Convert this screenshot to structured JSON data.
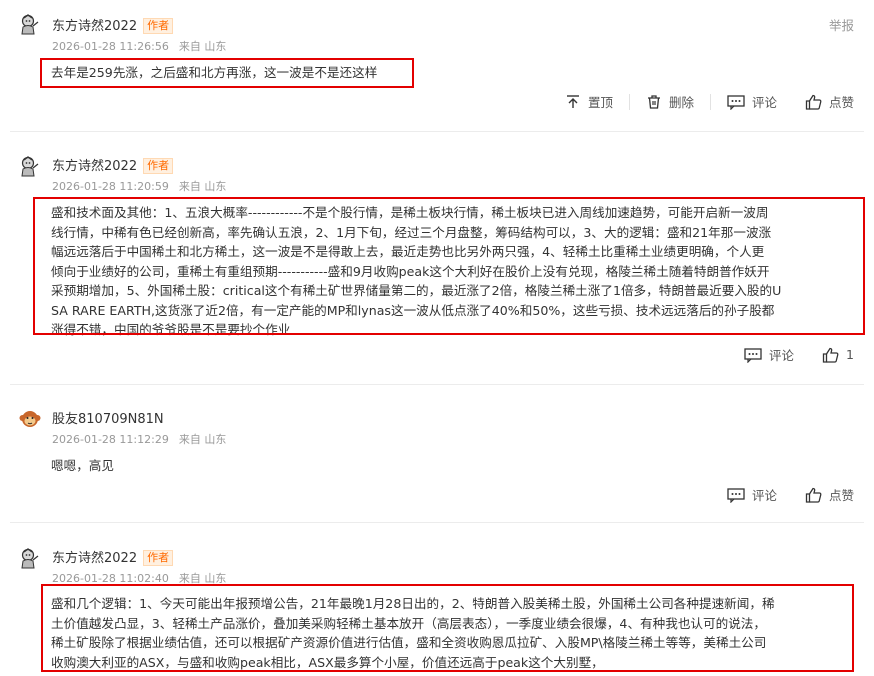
{
  "author_tag": "作者",
  "actions": {
    "pin": "置顶",
    "delete": "删除",
    "comment": "评论",
    "like": "点赞",
    "report": "举报"
  },
  "comments": [
    {
      "username": "东方诗然2022",
      "time": "2026-01-28 11:26:56",
      "location": "来自 山东",
      "text": "去年是259先涨，之后盛和北方再涨，这一波是不是还这样"
    },
    {
      "username": "东方诗然2022",
      "time": "2026-01-28 11:20:59",
      "location": "来自 山东",
      "lines": [
        "盛和技术面及其他：1、五浪大概率------------不是个股行情，是稀土板块行情，稀土板块已进入周线加速趋势，可能开启新一波周",
        "线行情，中稀有色已经创新高，率先确认五浪，2、1月下旬，经过三个月盘整，筹码结构可以，3、大的逻辑：盛和21年那一波涨",
        "幅远远落后于中国稀土和北方稀土，这一波是不是得敢上去，最近走势也比另外两只强，4、轻稀土比重稀土业绩更明确，个人更",
        "倾向于业绩好的公司，重稀土有重组预期-----------盛和9月收购peak这个大利好在股价上没有兑现，格陵兰稀土随着特朗普作妖开",
        "采预期增加，5、外国稀土股：critical这个有稀土矿世界储量第二的，最近涨了2倍，格陵兰稀土涨了1倍多，特朗普最近要入股的U",
        "SA RARE EARTH,这货涨了近2倍，有一定产能的MP和lynas这一波从低点涨了40%和50%，这些亏损、技术远远落后的孙子股都",
        "涨得不错，中国的爷爷股是不是要抄个作业"
      ],
      "like_count": "1"
    },
    {
      "username": "股友810709N81N",
      "time": "2026-01-28 11:12:29",
      "location": "来自 山东",
      "text": "嗯嗯，高见"
    },
    {
      "username": "东方诗然2022",
      "time": "2026-01-28 11:02:40",
      "location": "来自 山东",
      "lines": [
        "盛和几个逻辑：1、今天可能出年报预增公告，21年最晚1月28日出的，2、特朗普入股美稀土股，外国稀土公司各种提速新闻，稀",
        "土价值越发凸显，3、轻稀土产品涨价，叠加美采购轻稀土基本放开（高层表态），一季度业绩会很爆，4、有种我也认可的说法，",
        "稀土矿股除了根据业绩估值，还可以根据矿产资源价值进行估值，盛和全资收购恩瓜拉矿、入股MP\\格陵兰稀土等等，美稀土公司",
        "收购澳大利亚的ASX，与盛和收购peak相比，ASX最多算个小屋，价值还远高于peak这个大别墅，"
      ]
    }
  ]
}
